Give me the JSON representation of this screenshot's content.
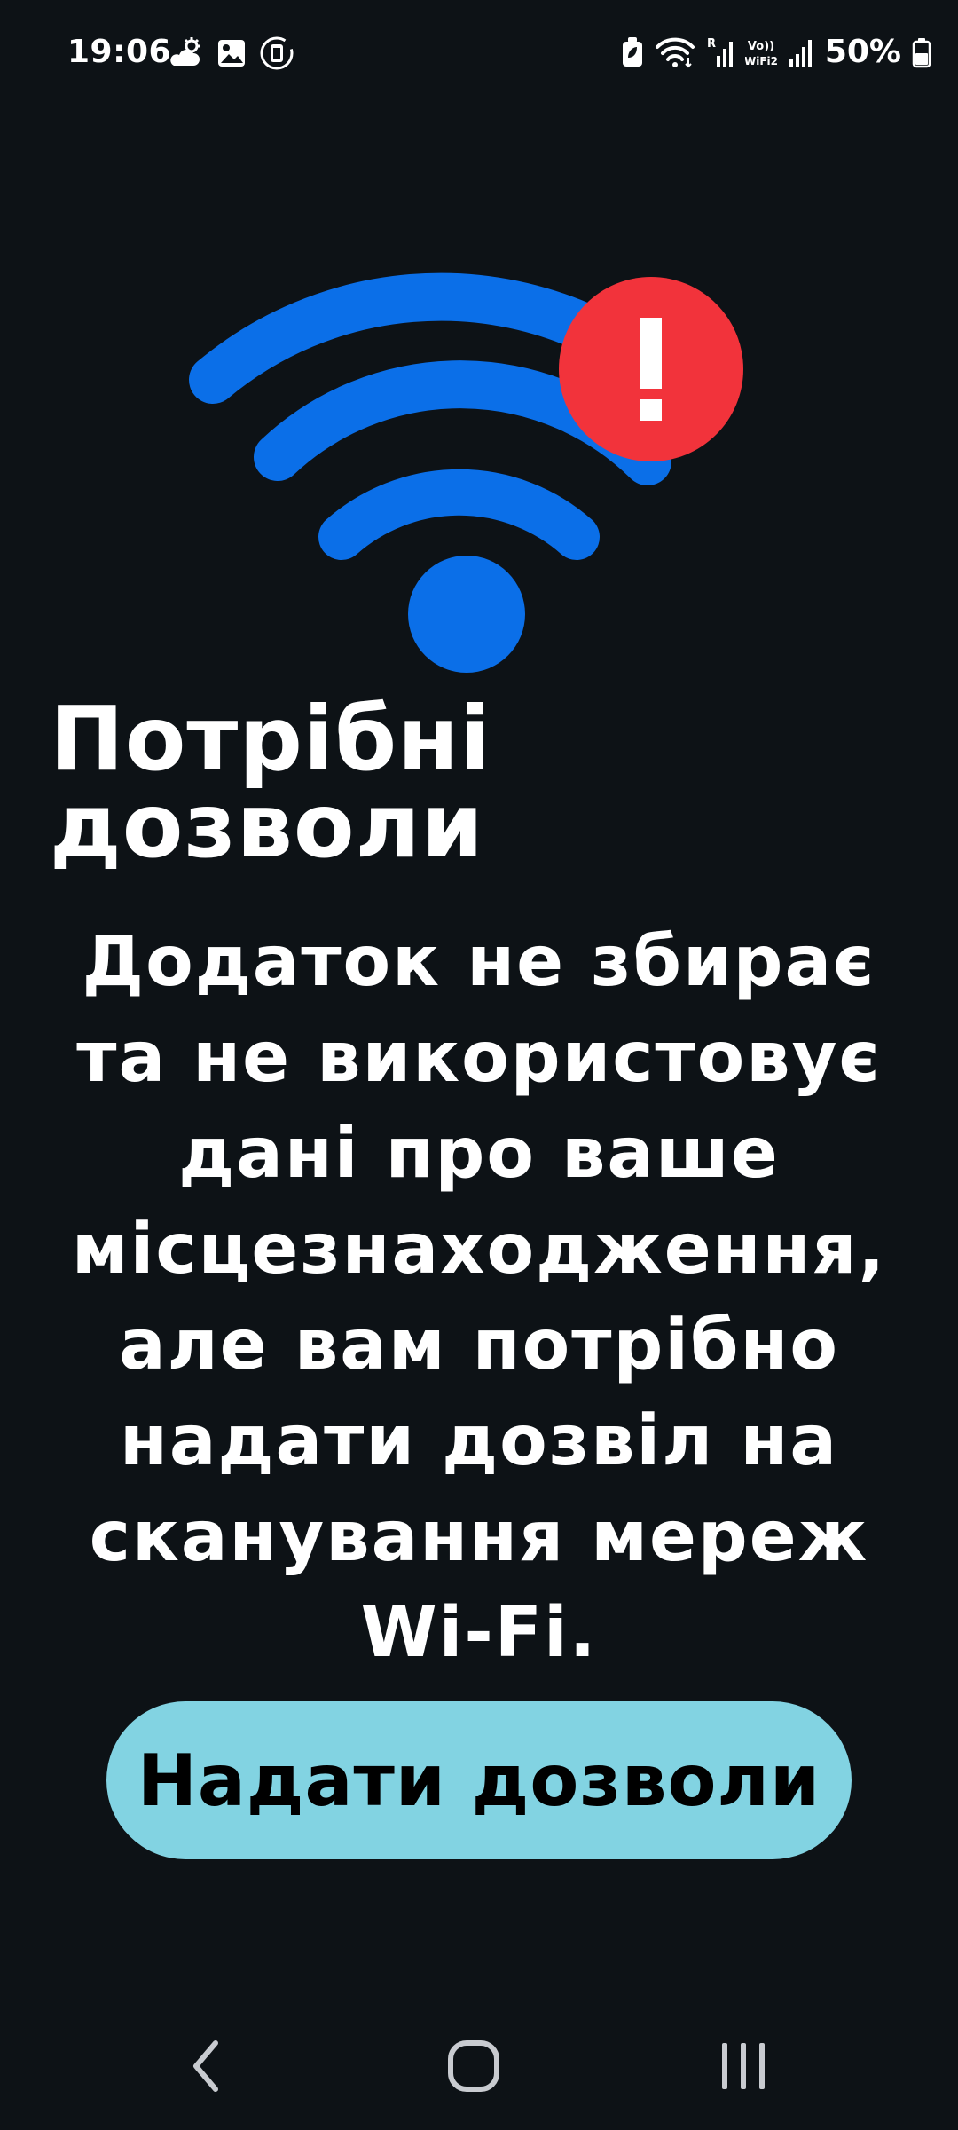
{
  "status_bar": {
    "time": "19:06",
    "battery_percent": "50%",
    "left_icons": [
      "weather-icon",
      "gallery-icon",
      "screen-recorder-icon"
    ],
    "right_icons": [
      "battery-saver-icon",
      "wifi-icon",
      "signal-roaming-icon",
      "volte-wifi-icon",
      "signal-bars-icon",
      "battery-icon"
    ],
    "volte_label_top": "Vo))",
    "volte_label_bottom": "WiFi2",
    "roaming_label": "R"
  },
  "hero": {
    "icon": "wifi-alert-icon",
    "wifi_color": "#0b6fe8",
    "alert_color": "#f2333b",
    "alert_glyph": "!"
  },
  "title": "Потрібні дозволи",
  "description": "Додаток не збирає та не використовує дані про ваше місцезнаходження, але вам потрібно надати дозвіл на сканування мереж Wi-Fi.",
  "grant_button": {
    "label": "Надати дозволи",
    "color": "#82d3e2"
  },
  "nav_bar": {
    "buttons": [
      "back-icon",
      "home-icon",
      "recent-apps-icon"
    ]
  }
}
